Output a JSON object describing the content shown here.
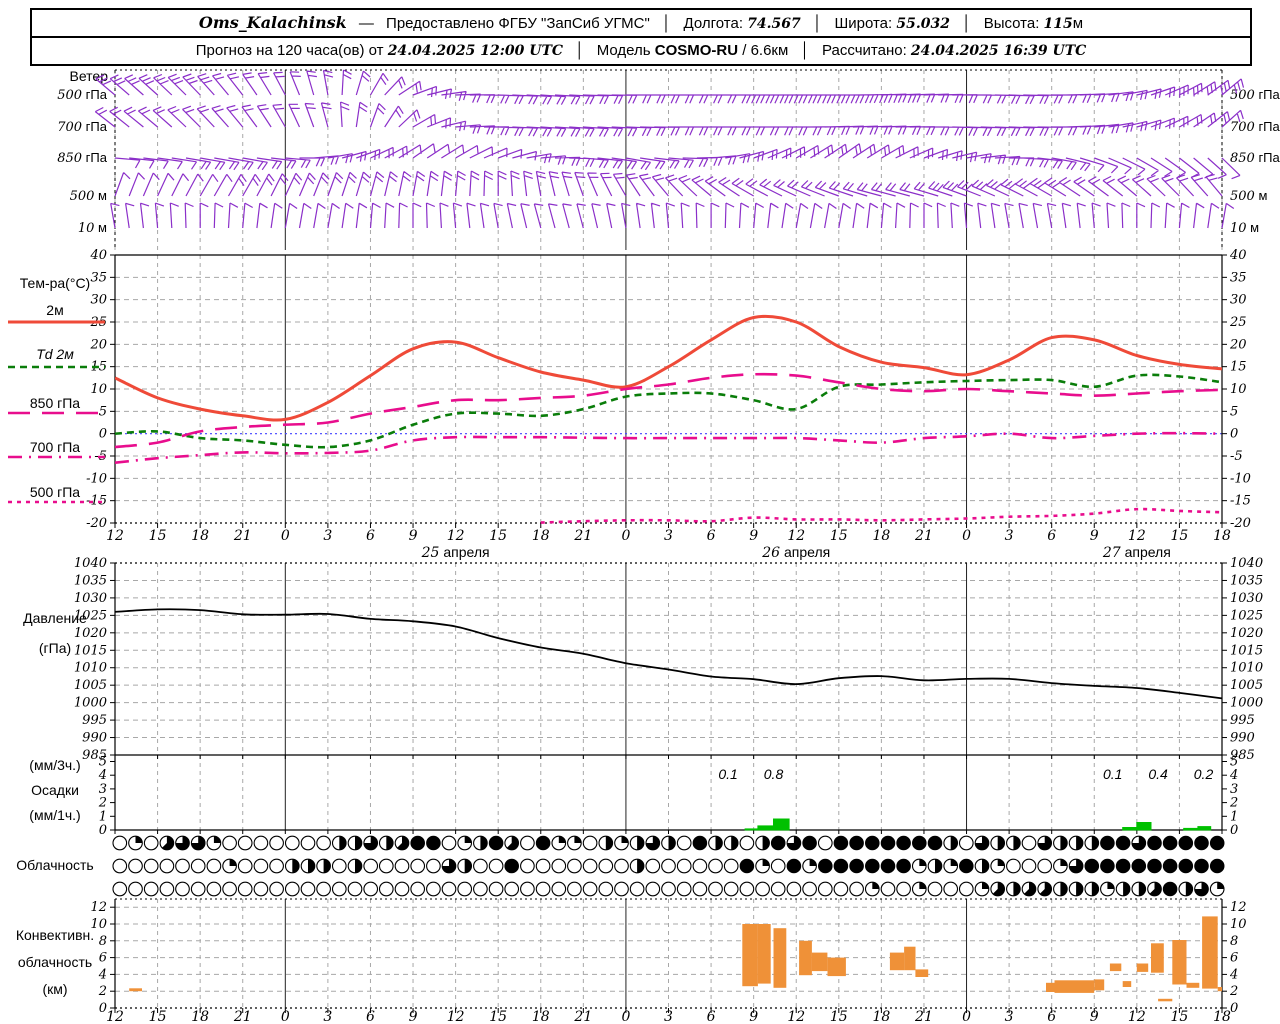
{
  "header": {
    "line1": {
      "station": "Oms_Kalachinsk",
      "dash": "—",
      "provided": "Предоставлено ФГБУ \"ЗапСиб УГМС\"",
      "sep": "│",
      "lon_label": "Долгота:",
      "lon": "74.567",
      "lat_label": "Широта:",
      "lat": "55.032",
      "alt_label": "Высота:",
      "alt": "115",
      "alt_unit": "м"
    },
    "line2": {
      "forecast": "Прогноз на 120 часа(ов) от",
      "run": "24.04.2025 12:00 UTC",
      "sep": "│",
      "model_label": "Модель",
      "model": "COSMO-RU",
      "model_res": "/ 6.6км",
      "calc_label": "Рассчитано:",
      "calc": "24.04.2025 16:39 UTC"
    }
  },
  "panels": {
    "wind": {
      "title": "Ветер",
      "levels": [
        "500 гПа",
        "700 гПа",
        "850 гПа",
        "500 м",
        "10 м"
      ]
    },
    "temp": {
      "title": "Тем-ра(°C)",
      "legend": [
        {
          "label": "2м",
          "style": "solid",
          "color": "#ef4a38"
        },
        {
          "label": "Td  2м",
          "style": "dashed",
          "color": "#0a7d0a"
        },
        {
          "label": "850 гПа",
          "style": "longdash",
          "color": "#e80d8d"
        },
        {
          "label": "700 гПа",
          "style": "dashdot",
          "color": "#e80d8d"
        },
        {
          "label": "500 гПа",
          "style": "shortdash",
          "color": "#e80d8d"
        }
      ]
    },
    "pressure": {
      "title1": "Давление",
      "title2": "(гПа)"
    },
    "precip": {
      "title1": "(мм/3ч.)",
      "title2": "Осадки",
      "title3": "(мм/1ч.)"
    },
    "cloud": {
      "title": "Облачность"
    },
    "conv": {
      "title1": "Конвективн.",
      "title2": "облачность",
      "title3": "(км)"
    }
  },
  "axis": {
    "x_tick_labels": [
      "12",
      "15",
      "18",
      "21",
      "0",
      "3",
      "6",
      "9",
      "12",
      "15",
      "18",
      "21",
      "0",
      "3",
      "6",
      "9",
      "12",
      "15",
      "18",
      "21",
      "0",
      "3",
      "6",
      "9",
      "12",
      "15",
      "18"
    ],
    "date_labels": [
      "25 апреля",
      "26 апреля",
      "27 апреля"
    ],
    "date_hours": [
      24,
      48,
      72
    ],
    "day_boundary_hours": [
      12,
      36,
      60
    ],
    "temp_ticks": [
      40,
      35,
      30,
      25,
      20,
      15,
      10,
      5,
      0,
      -5,
      -10,
      -15,
      -20
    ],
    "pressure_ticks": [
      1040,
      1035,
      1030,
      1025,
      1020,
      1015,
      1010,
      1005,
      1000,
      995,
      990,
      985
    ],
    "precip_ticks": [
      5,
      4,
      3,
      2,
      1,
      0
    ],
    "conv_ticks": [
      12,
      10,
      8,
      6,
      4,
      2,
      0
    ]
  },
  "colors": {
    "barb": "#8b2fc9",
    "red": "#ef4a38",
    "green": "#0a7d0a",
    "pink": "#e80d8d",
    "blue_zero": "#4242ff",
    "grid": "#a8a8a8",
    "orange": "#ef9138",
    "precip_bar": "#00c000",
    "black": "#000000"
  },
  "chart_data": [
    {
      "type": "wind-barbs",
      "title": "Ветер",
      "levels": [
        "500 гПа",
        "700 гПа",
        "850 гПа",
        "500 м",
        "10 м"
      ],
      "x_hours_step": 3,
      "barbs": {
        "lvl500hPa": {
          "angles": [
            310,
            312,
            316,
            322,
            332,
            350,
            30,
            70,
            88,
            92,
            94,
            92,
            90,
            90,
            90,
            90,
            90,
            90,
            88,
            88,
            90,
            92,
            90,
            86,
            76,
            62,
            50
          ],
          "feathers": [
            3,
            3,
            3,
            2,
            2,
            2,
            2,
            2,
            2,
            2,
            2,
            2,
            2,
            2,
            2,
            3,
            3,
            3,
            3,
            2,
            2,
            2,
            2,
            2,
            2,
            3,
            3
          ]
        },
        "lvl700hPa": {
          "angles": [
            308,
            310,
            315,
            320,
            330,
            345,
            20,
            60,
            85,
            92,
            94,
            94,
            92,
            90,
            90,
            90,
            90,
            88,
            88,
            90,
            92,
            92,
            90,
            84,
            74,
            60,
            48
          ],
          "feathers": [
            2,
            2,
            2,
            2,
            2,
            2,
            2,
            2,
            2,
            2,
            2,
            2,
            2,
            2,
            2,
            2,
            2,
            2,
            2,
            2,
            2,
            2,
            2,
            2,
            2,
            2,
            2
          ]
        },
        "lvl850hPa": {
          "angles": [
            95,
            98,
            100,
            100,
            95,
            80,
            65,
            55,
            60,
            70,
            85,
            95,
            100,
            95,
            85,
            70,
            60,
            55,
            60,
            70,
            80,
            90,
            100,
            110,
            120,
            128,
            134
          ],
          "feathers": [
            1,
            1,
            2,
            2,
            2,
            2,
            2,
            1,
            1,
            1,
            2,
            2,
            2,
            2,
            2,
            2,
            2,
            2,
            2,
            2,
            2,
            2,
            2,
            1,
            1,
            1,
            1
          ]
        },
        "lvl500m": {
          "angles": [
            20,
            25,
            30,
            30,
            25,
            20,
            15,
            10,
            5,
            0,
            350,
            340,
            330,
            320,
            310,
            300,
            295,
            290,
            285,
            285,
            290,
            295,
            300,
            305,
            310,
            315,
            320
          ],
          "feathers": [
            1,
            1,
            1,
            2,
            2,
            2,
            2,
            2,
            2,
            2,
            2,
            2,
            2,
            2,
            2,
            2,
            2,
            2,
            2,
            2,
            3,
            3,
            3,
            2,
            2,
            2,
            2
          ]
        },
        "lvl10m": {
          "angles": [
            350,
            355,
            0,
            5,
            10,
            10,
            5,
            0,
            355,
            350,
            345,
            345,
            350,
            355,
            0,
            5,
            10,
            10,
            5,
            0,
            355,
            350,
            350,
            355,
            0,
            5,
            10
          ],
          "feathers": [
            1,
            1,
            1,
            1,
            1,
            1,
            1,
            1,
            1,
            1,
            1,
            1,
            1,
            1,
            1,
            1,
            1,
            1,
            1,
            1,
            1,
            1,
            1,
            1,
            1,
            1,
            1
          ]
        }
      }
    },
    {
      "type": "line",
      "title": "Температура (°C)",
      "x_hours": [
        0,
        3,
        6,
        9,
        12,
        15,
        18,
        21,
        24,
        27,
        30,
        33,
        36,
        39,
        42,
        45,
        48,
        51,
        54,
        57,
        60,
        63,
        66,
        69,
        72,
        75,
        78
      ],
      "ylim": [
        -20,
        40
      ],
      "series": [
        {
          "name": "2м",
          "color": "#ef4a38",
          "style": "solid",
          "values": [
            12.5,
            8,
            5.5,
            4,
            3.2,
            7,
            13,
            19,
            20.5,
            17,
            13.8,
            12,
            10.5,
            15,
            21,
            26,
            25,
            19.5,
            16,
            14.8,
            13.2,
            16.5,
            21.5,
            21,
            17.5,
            15.5,
            14.5
          ]
        },
        {
          "name": "Td 2м",
          "color": "#0a7d0a",
          "style": "dashed",
          "values": [
            0,
            0.5,
            -1,
            -1.5,
            -2.5,
            -3,
            -1.5,
            2,
            4.5,
            4.5,
            4,
            5.5,
            8.3,
            9,
            9,
            7.5,
            5.5,
            10.5,
            11,
            11.5,
            11.8,
            12,
            12,
            10.5,
            13,
            12.8,
            11.5
          ]
        },
        {
          "name": "850 гПа",
          "color": "#e80d8d",
          "style": "longdash",
          "values": [
            -3,
            -2,
            0.5,
            1.5,
            2,
            2.5,
            4.5,
            6,
            7.5,
            7.5,
            8,
            8.5,
            10,
            11,
            12.5,
            13.3,
            13,
            11.5,
            10,
            9.5,
            10,
            9.5,
            9,
            8.5,
            9,
            9.5,
            9.8
          ]
        },
        {
          "name": "700 гПа",
          "color": "#e80d8d",
          "style": "dashdot",
          "values": [
            -6.5,
            -5.5,
            -4.8,
            -4.2,
            -4.4,
            -4.3,
            -3.8,
            -1.5,
            -0.8,
            -0.8,
            -0.8,
            -0.9,
            -1,
            -1,
            -1,
            -1,
            -1,
            -1.5,
            -2,
            -1,
            -0.6,
            0,
            -1,
            -0.5,
            0,
            0.1,
            0
          ]
        },
        {
          "name": "500 гПа",
          "color": "#e80d8d",
          "style": "shortdash",
          "values": [
            null,
            null,
            null,
            null,
            null,
            null,
            null,
            null,
            null,
            null,
            -19.9,
            -19.6,
            -19.4,
            -19.4,
            -19.6,
            -18.8,
            -19.2,
            -19.2,
            -19.4,
            -19.2,
            -19,
            -18.6,
            -18.4,
            -17.9,
            -16.9,
            -17.3,
            -17.6
          ]
        }
      ]
    },
    {
      "type": "line",
      "title": "Давление (гПа)",
      "x_hours": [
        0,
        3,
        6,
        9,
        12,
        15,
        18,
        21,
        24,
        27,
        30,
        33,
        36,
        39,
        42,
        45,
        48,
        51,
        54,
        57,
        60,
        63,
        66,
        69,
        72,
        75,
        78
      ],
      "ylim": [
        985,
        1040
      ],
      "series": [
        {
          "name": "Давление",
          "color": "#000000",
          "style": "solid",
          "values": [
            1026,
            1026.7,
            1026.5,
            1025.3,
            1025.2,
            1025.4,
            1024,
            1023.3,
            1021.8,
            1018.5,
            1015.8,
            1014,
            1011.3,
            1009.5,
            1007.5,
            1006.7,
            1005.3,
            1007,
            1007.6,
            1006.4,
            1006.8,
            1006.8,
            1005.6,
            1004.8,
            1004.2,
            1002.8,
            1001.2
          ]
        }
      ]
    },
    {
      "type": "bar",
      "title": "Осадки (мм/1ч.)",
      "ylim": [
        0,
        5
      ],
      "bars": [
        [
          44.4,
          45.3,
          0.08
        ],
        [
          45.3,
          46.4,
          0.3
        ],
        [
          46.4,
          47.5,
          0.8
        ],
        [
          71.0,
          72.0,
          0.18
        ],
        [
          72.0,
          73.0,
          0.55
        ],
        [
          75.3,
          76.3,
          0.12
        ],
        [
          76.3,
          77.2,
          0.25
        ]
      ],
      "sum_labels": [
        {
          "h": 43.2,
          "text": "0.1"
        },
        {
          "h": 46.4,
          "text": "0.8"
        },
        {
          "h": 70.3,
          "text": "0.1"
        },
        {
          "h": 73.5,
          "text": "0.4"
        },
        {
          "h": 76.7,
          "text": "0.2"
        }
      ]
    },
    {
      "type": "symbols",
      "title": "Облачность",
      "rows": 3,
      "octas_of_8": {
        "row1": [
          0,
          2,
          0,
          5,
          6,
          6,
          2,
          0,
          0,
          0,
          0,
          0,
          0,
          0,
          4,
          4,
          6,
          4,
          5,
          8,
          8,
          0,
          2,
          4,
          8,
          5,
          0,
          8,
          2,
          2,
          0,
          4,
          2,
          4,
          6,
          4,
          0,
          8,
          4,
          4,
          0,
          4,
          8,
          6,
          8,
          0,
          8,
          8,
          8,
          8,
          8,
          8,
          8,
          4,
          0,
          6,
          4,
          4,
          0,
          6,
          4,
          4,
          4,
          8,
          8,
          6,
          8,
          8,
          8,
          8,
          8
        ],
        "row2": [
          0,
          0,
          0,
          0,
          0,
          0,
          0,
          2,
          0,
          0,
          0,
          4,
          4,
          4,
          0,
          4,
          0,
          0,
          0,
          0,
          0,
          6,
          4,
          0,
          0,
          8,
          0,
          0,
          0,
          0,
          0,
          0,
          0,
          4,
          0,
          0,
          0,
          0,
          0,
          0,
          8,
          2,
          0,
          8,
          2,
          8,
          8,
          8,
          8,
          8,
          8,
          2,
          4,
          2,
          8,
          4,
          2,
          0,
          0,
          0,
          2,
          6,
          8,
          8,
          8,
          8,
          8,
          8,
          8,
          8,
          8
        ],
        "row3": [
          0,
          0,
          0,
          0,
          0,
          0,
          0,
          0,
          0,
          0,
          0,
          0,
          0,
          0,
          0,
          0,
          0,
          0,
          0,
          0,
          0,
          0,
          0,
          0,
          0,
          0,
          0,
          0,
          0,
          0,
          0,
          0,
          0,
          0,
          0,
          0,
          0,
          0,
          0,
          0,
          0,
          0,
          0,
          0,
          0,
          0,
          0,
          0,
          2,
          0,
          0,
          2,
          0,
          0,
          0,
          2,
          5,
          4,
          5,
          5,
          4,
          4,
          4,
          2,
          4,
          4,
          5,
          8,
          4,
          6,
          2
        ]
      }
    },
    {
      "type": "bar-range",
      "title": "Конвективная облачность (км)",
      "ylim": [
        0,
        12
      ],
      "segments": [
        [
          1.0,
          1.9,
          2.0,
          2.35
        ],
        [
          44.2,
          45.3,
          2.6,
          10.0
        ],
        [
          45.3,
          46.2,
          2.9,
          10.0
        ],
        [
          46.4,
          47.3,
          2.4,
          9.5
        ],
        [
          48.2,
          49.1,
          3.9,
          8.0
        ],
        [
          49.1,
          50.2,
          4.4,
          6.6
        ],
        [
          50.2,
          51.5,
          3.8,
          6.0
        ],
        [
          54.6,
          55.6,
          4.5,
          6.6
        ],
        [
          55.6,
          56.4,
          4.5,
          7.3
        ],
        [
          56.4,
          57.3,
          3.7,
          4.6
        ],
        [
          65.6,
          66.2,
          1.9,
          3.0
        ],
        [
          66.2,
          69.0,
          1.8,
          3.3
        ],
        [
          69.0,
          69.7,
          2.1,
          3.4
        ],
        [
          70.1,
          70.9,
          4.4,
          5.3
        ],
        [
          71.0,
          71.6,
          2.5,
          3.2
        ],
        [
          72.0,
          72.8,
          4.3,
          5.3
        ],
        [
          73.0,
          73.9,
          4.2,
          7.7
        ],
        [
          73.5,
          74.5,
          0.8,
          1.1
        ],
        [
          74.5,
          75.5,
          2.8,
          8.1
        ],
        [
          75.5,
          76.4,
          2.4,
          3.0
        ],
        [
          76.6,
          77.7,
          2.3,
          10.9
        ],
        [
          77.7,
          78.0,
          2.0,
          2.5
        ]
      ]
    }
  ]
}
